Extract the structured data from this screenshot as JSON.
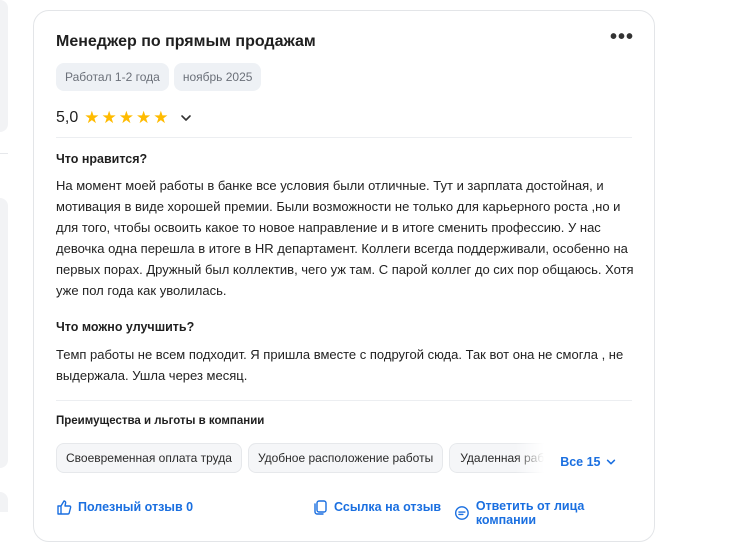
{
  "review": {
    "title": "Менеджер по прямым продажам",
    "more_glyph": "•••",
    "tags": [
      "Работал 1-2 года",
      "ноябрь 2025"
    ],
    "rating": "5,0",
    "stars": 5,
    "likes_heading": "Что нравится?",
    "likes_text": "На момент моей работы в банке все условия были отличные. Тут и зарплата достойная, и мотивация в виде хорошей премии. Были возможности не только для карьерного роста ,но и для того, чтобы освоить какое то новое направление и в итоге сменить профессию. У нас девочка одна перешла в итоге в HR департамент. Коллеги всегда поддерживали, особенно на первых порах. Дружный был коллектив, чего уж там. С парой коллег до сих пор общаюсь. Хотя уже пол года как уволилась.",
    "improve_heading": "Что можно улучшить?",
    "improve_text": "Темп работы не всем подходит. Я пришла вместе с подругой сюда. Так вот она не смогла , не выдержала. Ушла через месяц.",
    "benefits_heading": "Преимущества и льготы в компании",
    "benefits": [
      "Своевременная оплата труда",
      "Удобное расположение работы",
      "Удаленная работа"
    ],
    "benefits_all": "Все 15",
    "helpful": "Полезный отзыв 0",
    "link": "Ссылка на отзыв",
    "reply": "Ответить от лица компании"
  },
  "colors": {
    "accent": "#1a6fe0",
    "star": "#ffbb00",
    "tag_bg": "#eef1f5"
  }
}
